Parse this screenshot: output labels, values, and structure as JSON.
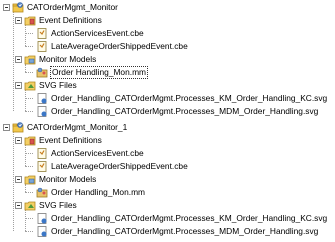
{
  "tree": {
    "projects": [
      {
        "name": "CATOrderMgmt_Monitor",
        "folders": [
          {
            "name": "Event Definitions",
            "children": [
              "ActionServicesEvent.cbe",
              "LateAverageOrderShippedEvent.cbe"
            ]
          },
          {
            "name": "Monitor Models",
            "children": [
              "Order Handling_Mon.mm"
            ]
          },
          {
            "name": "SVG Files",
            "children": [
              "Order_Handling_CATOrderMgmt.Processes_KM_Order_Handling_KC.svg",
              "Order_Handling_CATOrderMgmt.Processes_MDM_Order_Handling.svg"
            ]
          }
        ]
      },
      {
        "name": "CATOrderMgmt_Monitor_1",
        "folders": [
          {
            "name": "Event Definitions",
            "children": [
              "ActionServicesEvent.cbe",
              "LateAverageOrderShippedEvent.cbe"
            ]
          },
          {
            "name": "Monitor Models",
            "children": [
              "Order Handling_Mon.mm"
            ]
          },
          {
            "name": "SVG Files",
            "children": [
              "Order_Handling_CATOrderMgmt.Processes_KM_Order_Handling_KC.svg",
              "Order_Handling_CATOrderMgmt.Processes_MDM_Order_Handling.svg"
            ]
          }
        ]
      }
    ]
  }
}
